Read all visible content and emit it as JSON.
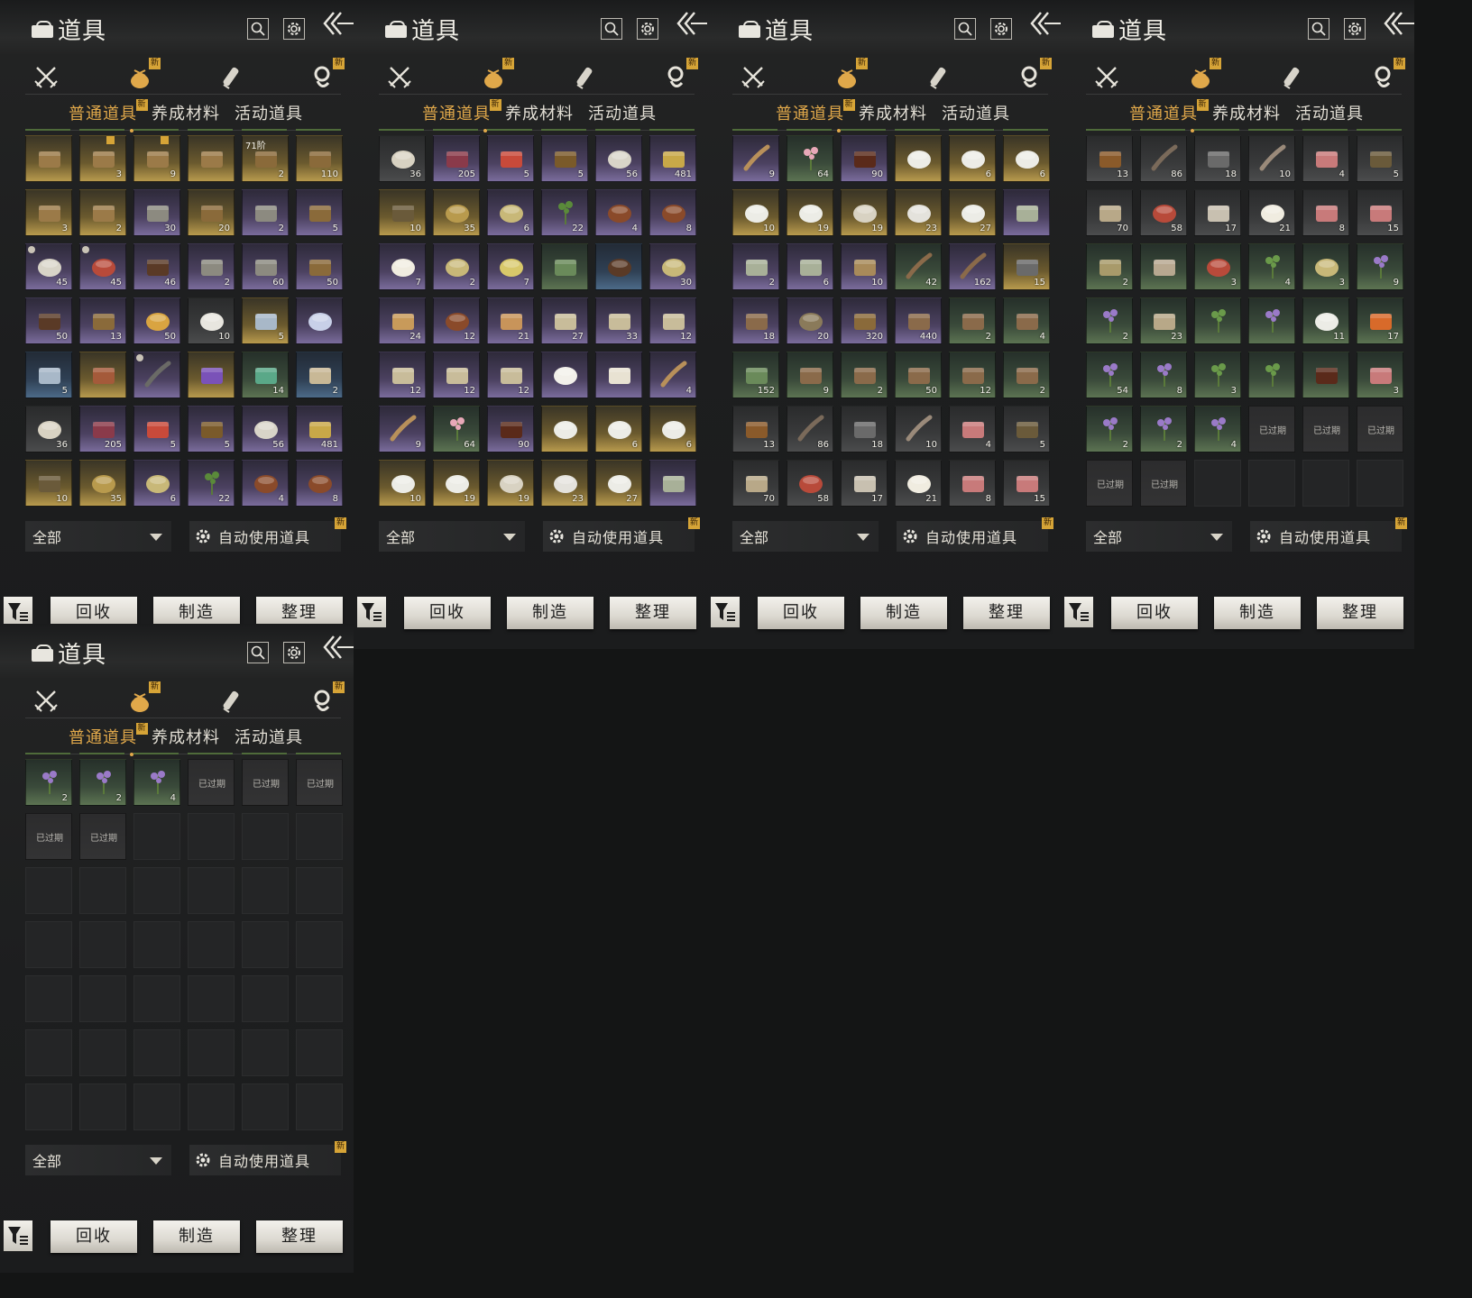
{
  "window_title": "道具",
  "icons": {
    "bag": "bag-icon",
    "search": "search-icon",
    "settings": "gear-icon",
    "back": "back-arrow-icon",
    "filter": "filter-icon"
  },
  "colors": {
    "accent": "#e0a84a",
    "new_badge": "#d6a437",
    "rarity_gold": "#b89a4d",
    "rarity_purple": "#7a6c9c",
    "rarity_green": "#5c7352",
    "rarity_blue": "#4c6a88"
  },
  "category_tabs": [
    {
      "icon": "crossed-swords-icon",
      "new": false,
      "active": false
    },
    {
      "icon": "item-pouch-icon",
      "new": true,
      "active": true
    },
    {
      "icon": "scroll-icon",
      "new": false,
      "active": false
    },
    {
      "icon": "currency-icon",
      "new": true,
      "active": false
    }
  ],
  "new_badge_text": "新",
  "sub_tabs": [
    {
      "label": "普通道具",
      "active": true,
      "new": true
    },
    {
      "label": "养成材料",
      "active": false,
      "new": false
    },
    {
      "label": "活动道具",
      "active": false,
      "new": false
    }
  ],
  "filter_dropdown": {
    "label": "全部",
    "icon": "caret-down-icon"
  },
  "auto_use": {
    "label": "自动使用道具",
    "icon": "gear-icon",
    "new": true
  },
  "actions": [
    {
      "label": "回收"
    },
    {
      "label": "制造"
    },
    {
      "label": "整理"
    }
  ],
  "panels": [
    {
      "items": [
        {
          "r": "gold",
          "q": "",
          "art": "chest-heart",
          "badge": false
        },
        {
          "r": "gold",
          "q": "3",
          "art": "chest-heart",
          "badge": true
        },
        {
          "r": "gold",
          "q": "9",
          "art": "chest-heart",
          "badge": true
        },
        {
          "r": "gold",
          "q": "",
          "art": "chest-heart",
          "badge": false
        },
        {
          "r": "gold",
          "q": "2",
          "art": "chest",
          "tag": "71阶"
        },
        {
          "r": "gold",
          "q": "110",
          "art": "chest"
        },
        {
          "r": "gold",
          "q": "3",
          "art": "chest-heart"
        },
        {
          "r": "gold",
          "q": "2",
          "art": "chest-heart"
        },
        {
          "r": "purple",
          "q": "30",
          "art": "pouch"
        },
        {
          "r": "gold",
          "q": "20",
          "art": "chest"
        },
        {
          "r": "purple",
          "q": "2",
          "art": "pouch"
        },
        {
          "r": "purple",
          "q": "5",
          "art": "chest"
        },
        {
          "r": "purple",
          "q": "45",
          "art": "orb",
          "mark": true
        },
        {
          "r": "purple",
          "q": "45",
          "art": "orb-red",
          "mark": true
        },
        {
          "r": "purple",
          "q": "46",
          "art": "cabinet"
        },
        {
          "r": "purple",
          "q": "2",
          "art": "pouch"
        },
        {
          "r": "purple",
          "q": "60",
          "art": "pouch"
        },
        {
          "r": "purple",
          "q": "50",
          "art": "chest"
        },
        {
          "r": "purple",
          "q": "50",
          "art": "cabinet"
        },
        {
          "r": "purple",
          "q": "13",
          "art": "chest"
        },
        {
          "r": "purple",
          "q": "50",
          "art": "orb-gold"
        },
        {
          "r": "gray",
          "q": "10",
          "art": "emblem"
        },
        {
          "r": "gold",
          "q": "5",
          "art": "shards"
        },
        {
          "r": "purple",
          "q": "",
          "art": "ball"
        },
        {
          "r": "blue",
          "q": "5",
          "art": "shards"
        },
        {
          "r": "gold",
          "q": "",
          "art": "scroll"
        },
        {
          "r": "purple",
          "q": "",
          "art": "staff",
          "mark": true
        },
        {
          "r": "gold",
          "q": "",
          "art": "crystal"
        },
        {
          "r": "green",
          "q": "14",
          "art": "ticket"
        },
        {
          "r": "blue",
          "q": "2",
          "art": "map"
        },
        {
          "r": "gray",
          "q": "36",
          "art": "bowl-lid"
        },
        {
          "r": "purple",
          "q": "205",
          "art": "book"
        },
        {
          "r": "purple",
          "q": "5",
          "art": "red-envelope"
        },
        {
          "r": "purple",
          "q": "5",
          "art": "plaque"
        },
        {
          "r": "purple",
          "q": "56",
          "art": "jade"
        },
        {
          "r": "purple",
          "q": "481",
          "art": "tassel"
        },
        {
          "r": "gold",
          "q": "10",
          "art": "pot"
        },
        {
          "r": "gold",
          "q": "35",
          "art": "coin"
        },
        {
          "r": "purple",
          "q": "6",
          "art": "dish"
        },
        {
          "r": "purple",
          "q": "22",
          "art": "leaves"
        },
        {
          "r": "purple",
          "q": "4",
          "art": "dish-meat"
        },
        {
          "r": "purple",
          "q": "8",
          "art": "dish-meat"
        }
      ]
    },
    {
      "items": [
        {
          "r": "gray",
          "q": "36",
          "art": "bowl-lid"
        },
        {
          "r": "purple",
          "q": "205",
          "art": "book"
        },
        {
          "r": "purple",
          "q": "5",
          "art": "red-envelope"
        },
        {
          "r": "purple",
          "q": "5",
          "art": "plaque"
        },
        {
          "r": "purple",
          "q": "56",
          "art": "jade"
        },
        {
          "r": "purple",
          "q": "481",
          "art": "tassel"
        },
        {
          "r": "gold",
          "q": "10",
          "art": "pot"
        },
        {
          "r": "gold",
          "q": "35",
          "art": "coin"
        },
        {
          "r": "purple",
          "q": "6",
          "art": "dish"
        },
        {
          "r": "purple",
          "q": "22",
          "art": "leaves"
        },
        {
          "r": "purple",
          "q": "4",
          "art": "dish-meat"
        },
        {
          "r": "purple",
          "q": "8",
          "art": "dish-meat"
        },
        {
          "r": "purple",
          "q": "7",
          "art": "eggs"
        },
        {
          "r": "purple",
          "q": "2",
          "art": "dish"
        },
        {
          "r": "purple",
          "q": "7",
          "art": "soup"
        },
        {
          "r": "green",
          "q": "",
          "art": "bamboo"
        },
        {
          "r": "blue",
          "q": "",
          "art": "chestnuts"
        },
        {
          "r": "purple",
          "q": "30",
          "art": "dish"
        },
        {
          "r": "purple",
          "q": "24",
          "art": "cake"
        },
        {
          "r": "purple",
          "q": "12",
          "art": "dish-meat"
        },
        {
          "r": "purple",
          "q": "21",
          "art": "dumplings"
        },
        {
          "r": "purple",
          "q": "27",
          "art": "paper"
        },
        {
          "r": "purple",
          "q": "33",
          "art": "paper"
        },
        {
          "r": "purple",
          "q": "12",
          "art": "paper"
        },
        {
          "r": "purple",
          "q": "12",
          "art": "paper"
        },
        {
          "r": "purple",
          "q": "12",
          "art": "paper"
        },
        {
          "r": "purple",
          "q": "12",
          "art": "paper"
        },
        {
          "r": "purple",
          "q": "",
          "art": "egg"
        },
        {
          "r": "purple",
          "q": "",
          "art": "letter"
        },
        {
          "r": "purple",
          "q": "4",
          "art": "horn"
        },
        {
          "r": "purple",
          "q": "9",
          "art": "horn"
        },
        {
          "r": "green",
          "q": "64",
          "art": "blossom"
        },
        {
          "r": "purple",
          "q": "90",
          "art": "jar"
        },
        {
          "r": "gold",
          "q": "",
          "art": "bowl"
        },
        {
          "r": "gold",
          "q": "6",
          "art": "bowl"
        },
        {
          "r": "gold",
          "q": "6",
          "art": "bowl"
        },
        {
          "r": "gold",
          "q": "10",
          "art": "bowl"
        },
        {
          "r": "gold",
          "q": "19",
          "art": "bowl"
        },
        {
          "r": "gold",
          "q": "19",
          "art": "bowl-lid"
        },
        {
          "r": "gold",
          "q": "23",
          "art": "plate"
        },
        {
          "r": "gold",
          "q": "27",
          "art": "bowl"
        },
        {
          "r": "purple",
          "q": "",
          "art": "vase"
        }
      ]
    },
    {
      "items": [
        {
          "r": "purple",
          "q": "9",
          "art": "horn"
        },
        {
          "r": "green",
          "q": "64",
          "art": "blossom"
        },
        {
          "r": "purple",
          "q": "90",
          "art": "jar"
        },
        {
          "r": "gold",
          "q": "",
          "art": "bowl"
        },
        {
          "r": "gold",
          "q": "6",
          "art": "bowl"
        },
        {
          "r": "gold",
          "q": "6",
          "art": "bowl"
        },
        {
          "r": "gold",
          "q": "10",
          "art": "bowl"
        },
        {
          "r": "gold",
          "q": "19",
          "art": "bowl"
        },
        {
          "r": "gold",
          "q": "19",
          "art": "bowl-lid"
        },
        {
          "r": "gold",
          "q": "23",
          "art": "plate"
        },
        {
          "r": "gold",
          "q": "27",
          "art": "bowl"
        },
        {
          "r": "purple",
          "q": "",
          "art": "vase"
        },
        {
          "r": "purple",
          "q": "2",
          "art": "vase"
        },
        {
          "r": "purple",
          "q": "6",
          "art": "vase"
        },
        {
          "r": "purple",
          "q": "10",
          "art": "planks"
        },
        {
          "r": "green",
          "q": "42",
          "art": "arrow"
        },
        {
          "r": "purple",
          "q": "162",
          "art": "arrow"
        },
        {
          "r": "gold",
          "q": "15",
          "art": "ore"
        },
        {
          "r": "purple",
          "q": "18",
          "art": "logs"
        },
        {
          "r": "purple",
          "q": "20",
          "art": "wheel"
        },
        {
          "r": "purple",
          "q": "320",
          "art": "blocks"
        },
        {
          "r": "purple",
          "q": "440",
          "art": "logs"
        },
        {
          "r": "green",
          "q": "2",
          "art": "logs"
        },
        {
          "r": "green",
          "q": "4",
          "art": "logs"
        },
        {
          "r": "green",
          "q": "152",
          "art": "bamboo"
        },
        {
          "r": "green",
          "q": "9",
          "art": "logs"
        },
        {
          "r": "green",
          "q": "2",
          "art": "logs"
        },
        {
          "r": "green",
          "q": "50",
          "art": "logs"
        },
        {
          "r": "green",
          "q": "12",
          "art": "logs"
        },
        {
          "r": "green",
          "q": "2",
          "art": "logs"
        },
        {
          "r": "gray",
          "q": "13",
          "art": "bark"
        },
        {
          "r": "gray",
          "q": "86",
          "art": "sticks"
        },
        {
          "r": "gray",
          "q": "18",
          "art": "ore"
        },
        {
          "r": "gray",
          "q": "10",
          "art": "feather"
        },
        {
          "r": "gray",
          "q": "4",
          "art": "meat"
        },
        {
          "r": "gray",
          "q": "5",
          "art": "insect"
        },
        {
          "r": "gray",
          "q": "70",
          "art": "sack"
        },
        {
          "r": "gray",
          "q": "58",
          "art": "berries"
        },
        {
          "r": "gray",
          "q": "17",
          "art": "mushroom"
        },
        {
          "r": "gray",
          "q": "21",
          "art": "eggs"
        },
        {
          "r": "gray",
          "q": "8",
          "art": "meat"
        },
        {
          "r": "gray",
          "q": "15",
          "art": "meat"
        }
      ]
    },
    {
      "items": [
        {
          "r": "gray",
          "q": "13",
          "art": "bark"
        },
        {
          "r": "gray",
          "q": "86",
          "art": "sticks"
        },
        {
          "r": "gray",
          "q": "18",
          "art": "ore"
        },
        {
          "r": "gray",
          "q": "10",
          "art": "feather"
        },
        {
          "r": "gray",
          "q": "4",
          "art": "meat"
        },
        {
          "r": "gray",
          "q": "5",
          "art": "insect"
        },
        {
          "r": "gray",
          "q": "70",
          "art": "sack"
        },
        {
          "r": "gray",
          "q": "58",
          "art": "berries"
        },
        {
          "r": "gray",
          "q": "17",
          "art": "mushroom"
        },
        {
          "r": "gray",
          "q": "21",
          "art": "eggs"
        },
        {
          "r": "gray",
          "q": "8",
          "art": "meat"
        },
        {
          "r": "gray",
          "q": "15",
          "art": "meat"
        },
        {
          "r": "green",
          "q": "2",
          "art": "corn"
        },
        {
          "r": "green",
          "q": "",
          "art": "hide"
        },
        {
          "r": "green",
          "q": "3",
          "art": "orb-red"
        },
        {
          "r": "green",
          "q": "4",
          "art": "herb"
        },
        {
          "r": "green",
          "q": "3",
          "art": "dish"
        },
        {
          "r": "green",
          "q": "9",
          "art": "flower"
        },
        {
          "r": "green",
          "q": "2",
          "art": "flower"
        },
        {
          "r": "green",
          "q": "23",
          "art": "sack"
        },
        {
          "r": "green",
          "q": "",
          "art": "herb"
        },
        {
          "r": "green",
          "q": "",
          "art": "flower"
        },
        {
          "r": "green",
          "q": "11",
          "art": "bowl"
        },
        {
          "r": "green",
          "q": "17",
          "art": "fish"
        },
        {
          "r": "green",
          "q": "54",
          "art": "flower"
        },
        {
          "r": "green",
          "q": "8",
          "art": "flower"
        },
        {
          "r": "green",
          "q": "3",
          "art": "herb"
        },
        {
          "r": "green",
          "q": "",
          "art": "herb"
        },
        {
          "r": "green",
          "q": "",
          "art": "jar"
        },
        {
          "r": "green",
          "q": "3",
          "art": "meat"
        },
        {
          "r": "green",
          "q": "2",
          "art": "flower"
        },
        {
          "r": "green",
          "q": "2",
          "art": "flower"
        },
        {
          "r": "green",
          "q": "4",
          "art": "flower"
        },
        {
          "r": "expired",
          "exp": "已过期"
        },
        {
          "r": "expired",
          "exp": "已过期"
        },
        {
          "r": "expired",
          "exp": "已过期"
        },
        {
          "r": "expired",
          "exp": "已过期"
        },
        {
          "r": "expired",
          "exp": "已过期"
        },
        {
          "r": "empty"
        },
        {
          "r": "empty"
        },
        {
          "r": "empty"
        },
        {
          "r": "empty"
        }
      ]
    },
    {
      "items": [
        {
          "r": "green",
          "q": "2",
          "art": "flower"
        },
        {
          "r": "green",
          "q": "2",
          "art": "flower"
        },
        {
          "r": "green",
          "q": "4",
          "art": "flower"
        },
        {
          "r": "expired",
          "exp": "已过期"
        },
        {
          "r": "expired",
          "exp": "已过期"
        },
        {
          "r": "expired",
          "exp": "已过期"
        },
        {
          "r": "expired",
          "exp": "已过期"
        },
        {
          "r": "expired",
          "exp": "已过期"
        },
        {
          "r": "empty"
        },
        {
          "r": "empty"
        },
        {
          "r": "empty"
        },
        {
          "r": "empty"
        },
        {
          "r": "empty"
        },
        {
          "r": "empty"
        },
        {
          "r": "empty"
        },
        {
          "r": "empty"
        },
        {
          "r": "empty"
        },
        {
          "r": "empty"
        },
        {
          "r": "empty"
        },
        {
          "r": "empty"
        },
        {
          "r": "empty"
        },
        {
          "r": "empty"
        },
        {
          "r": "empty"
        },
        {
          "r": "empty"
        },
        {
          "r": "empty"
        },
        {
          "r": "empty"
        },
        {
          "r": "empty"
        },
        {
          "r": "empty"
        },
        {
          "r": "empty"
        },
        {
          "r": "empty"
        },
        {
          "r": "empty"
        },
        {
          "r": "empty"
        },
        {
          "r": "empty"
        },
        {
          "r": "empty"
        },
        {
          "r": "empty"
        },
        {
          "r": "empty"
        },
        {
          "r": "empty"
        },
        {
          "r": "empty"
        },
        {
          "r": "empty"
        },
        {
          "r": "empty"
        },
        {
          "r": "empty"
        },
        {
          "r": "empty"
        }
      ]
    }
  ]
}
